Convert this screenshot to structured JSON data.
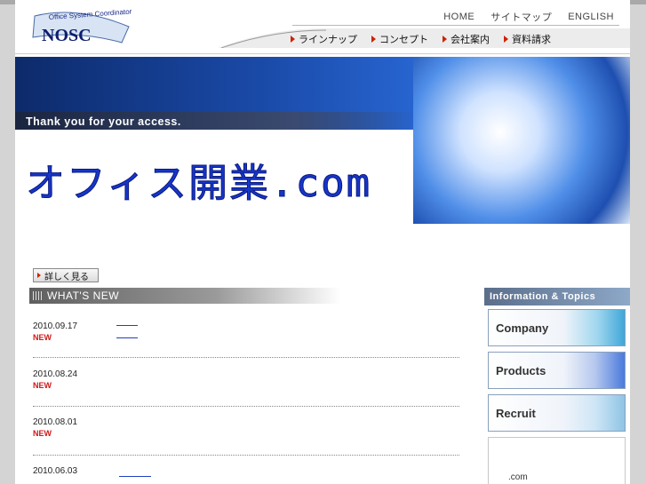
{
  "header": {
    "logo_text": "NOSC",
    "logo_tagline": "Office System Coordinator",
    "util_nav": [
      "HOME",
      "サイトマップ",
      "ENGLISH"
    ],
    "main_nav": [
      "ラインナップ",
      "コンセプト",
      "会社案内",
      "資料請求"
    ]
  },
  "hero": {
    "thanks": "Thank you for your access.",
    "big_title": "オフィス開業.com"
  },
  "more_button": "詳しく見る",
  "whats_new": {
    "title": "WHAT'S NEW",
    "items": [
      {
        "date": "2010.09.17",
        "badge": "NEW"
      },
      {
        "date": "2010.08.24",
        "badge": "NEW"
      },
      {
        "date": "2010.08.01",
        "badge": "NEW"
      },
      {
        "date": "2010.06.03",
        "badge": ""
      }
    ]
  },
  "sidebar": {
    "title": "Information & Topics",
    "buttons": [
      "Company",
      "Products",
      "Recruit"
    ],
    "box_text": ".com"
  },
  "colors": {
    "accent_blue": "#1736c8",
    "new_red": "#d01818",
    "nav_arrow": "#cc2200"
  }
}
